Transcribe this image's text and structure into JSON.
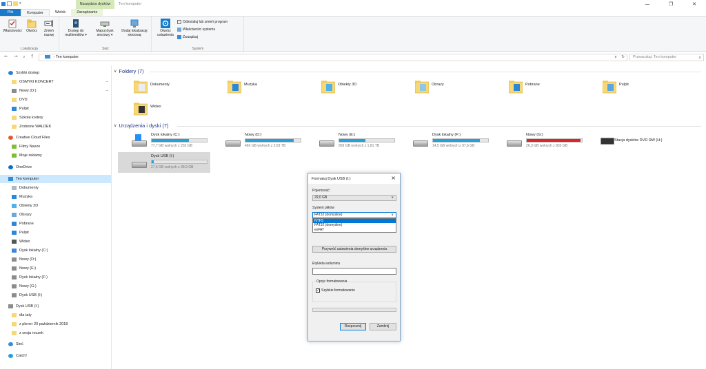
{
  "titlebar": {
    "context_tab_label": "Narzędzia dysków",
    "window_title": "Ten komputer",
    "controls": [
      "—",
      "❐",
      "✕"
    ]
  },
  "ribbon_tabs": [
    "Plik",
    "Komputer",
    "Widok",
    "Zarządzanie"
  ],
  "ribbon": {
    "groups": [
      {
        "label": "Lokalizacja",
        "buttons": [
          "Właściwości",
          "Otwórz",
          "Zmień nazwę"
        ]
      },
      {
        "label": "Sieć",
        "buttons": [
          "Dostęp do multimediów ▾",
          "Mapuj dysk sieciowy ▾",
          "Dodaj lokalizację sieciową"
        ]
      },
      {
        "label": "System",
        "buttons": [
          "Otwórz ustawienia"
        ],
        "small": [
          "Odinstaluj lub zmień program",
          "Właściwości systemu",
          "Zarządzaj"
        ]
      }
    ]
  },
  "address": {
    "path": "Ten komputer",
    "search_placeholder": "Przeszukaj: Ten komputer",
    "nav": [
      "←",
      "→",
      "∨",
      "↑"
    ]
  },
  "nav_pane": [
    {
      "label": "Szybki dostęp",
      "icon": "star-icon",
      "indent": 0,
      "color": "#2f7fd1"
    },
    {
      "label": "OSMYKI KONCERT",
      "icon": "folder-icon",
      "indent": 1,
      "pinned": true,
      "color": "#f8d775"
    },
    {
      "label": "Nowy (D:)",
      "icon": "drive-icon",
      "indent": 1,
      "pinned": true,
      "color": "#8c8c8c"
    },
    {
      "label": "DVD",
      "icon": "folder-icon",
      "indent": 1,
      "color": "#f8d775"
    },
    {
      "label": "Pulpit",
      "icon": "desktop-icon",
      "indent": 1,
      "color": "#2b88d8"
    },
    {
      "label": "Szkoła kodery",
      "icon": "folder-icon",
      "indent": 1,
      "color": "#f8d775"
    },
    {
      "label": "Zrobione WALDEK",
      "icon": "folder-icon",
      "indent": 1,
      "color": "#f8d775"
    },
    {
      "label": "Creative Cloud Files",
      "icon": "creative-cloud-icon",
      "indent": 0,
      "color": "#e8552f"
    },
    {
      "label": "Filmy Nasze",
      "icon": "folder-sync-icon",
      "indent": 1,
      "color": "#7fbd3a"
    },
    {
      "label": "Moje reklamy",
      "icon": "folder-sync-icon",
      "indent": 1,
      "color": "#7fbd3a"
    },
    {
      "label": "OneDrive",
      "icon": "onedrive-icon",
      "indent": 0,
      "color": "#0f6ecd"
    },
    {
      "label": "Ten komputer",
      "icon": "computer-icon",
      "indent": 0,
      "selected": true,
      "color": "#3a8ad6"
    },
    {
      "label": "Dokumenty",
      "icon": "documents-icon",
      "indent": 1,
      "color": "#b0b8c4"
    },
    {
      "label": "Muzyka",
      "icon": "music-icon",
      "indent": 1,
      "color": "#2b88d8"
    },
    {
      "label": "Obiekty 3D",
      "icon": "objects-3d-icon",
      "indent": 1,
      "color": "#4fb3e8"
    },
    {
      "label": "Obrazy",
      "icon": "pictures-icon",
      "indent": 1,
      "color": "#6fa8d6"
    },
    {
      "label": "Pobrane",
      "icon": "downloads-icon",
      "indent": 1,
      "color": "#2b88d8"
    },
    {
      "label": "Pulpit",
      "icon": "desktop-icon",
      "indent": 1,
      "color": "#2b88d8"
    },
    {
      "label": "Wideo",
      "icon": "video-icon",
      "indent": 1,
      "color": "#555555"
    },
    {
      "label": "Dysk lokalny (C:)",
      "icon": "windows-drive-icon",
      "indent": 1,
      "color": "#3a8ad6"
    },
    {
      "label": "Nowy (D:)",
      "icon": "drive-icon",
      "indent": 1,
      "color": "#8c8c8c"
    },
    {
      "label": "Nowy (E:)",
      "icon": "drive-icon",
      "indent": 1,
      "color": "#8c8c8c"
    },
    {
      "label": "Dysk lokalny (F:)",
      "icon": "drive-icon",
      "indent": 1,
      "color": "#8c8c8c"
    },
    {
      "label": "Nowy (G:)",
      "icon": "drive-icon",
      "indent": 1,
      "color": "#8c8c8c"
    },
    {
      "label": "Dysk USB (I:)",
      "icon": "usb-drive-icon",
      "indent": 1,
      "color": "#8c8c8c"
    },
    {
      "label": "Dysk USB (I:)",
      "icon": "usb-drive-icon",
      "indent": 0,
      "color": "#8c8c8c"
    },
    {
      "label": "dla taty",
      "icon": "folder-icon",
      "indent": 1,
      "color": "#f8d775"
    },
    {
      "label": "z plener 20 październik 2018",
      "icon": "folder-icon",
      "indent": 1,
      "color": "#f8d775"
    },
    {
      "label": "z sesja roczek",
      "icon": "folder-icon",
      "indent": 1,
      "color": "#f8d775"
    },
    {
      "label": "Sieć",
      "icon": "network-icon",
      "indent": 0,
      "color": "#3a8ad6"
    },
    {
      "label": "Catch!",
      "icon": "catch-icon",
      "indent": 0,
      "color": "#1fa0e0"
    }
  ],
  "folders_header": "Foldery (7)",
  "folders": [
    {
      "label": "Dokumenty",
      "icon": "documents-folder-icon"
    },
    {
      "label": "Muzyka",
      "icon": "music-folder-icon"
    },
    {
      "label": "Obiekty 3D",
      "icon": "objects-3d-folder-icon"
    },
    {
      "label": "Obrazy",
      "icon": "pictures-folder-icon"
    },
    {
      "label": "Pobrane",
      "icon": "downloads-folder-icon"
    },
    {
      "label": "Pulpit",
      "icon": "desktop-folder-icon"
    },
    {
      "label": "Wideo",
      "icon": "video-folder-icon"
    }
  ],
  "drives_header": "Urządzenia i dyski (7)",
  "drives": [
    {
      "label": "Dysk lokalny (C:)",
      "free": "77,7 GB wolnych z 232 GB",
      "used_fraction": 0.67,
      "icon": "windows-drive-icon"
    },
    {
      "label": "Nowy (D:)",
      "free": "469 GB wolnych z 3,63 TB",
      "used_fraction": 0.87,
      "icon": "hdd-icon"
    },
    {
      "label": "Nowy (E:)",
      "free": "959 GB wolnych z 1,81 TB",
      "used_fraction": 0.48,
      "icon": "hdd-icon"
    },
    {
      "label": "Dysk lokalny (F:)",
      "free": "14,5 GB wolnych z 97,6 GB",
      "used_fraction": 0.85,
      "icon": "hdd-icon"
    },
    {
      "label": "Nowy (G:)",
      "free": "26,3 GB wolnych z 833 GB",
      "used_fraction": 0.97,
      "red": true,
      "icon": "hdd-icon"
    },
    {
      "label": "Stacja dysków DVD RW (H:)",
      "free": "",
      "used_fraction": null,
      "icon": "dvd-drive-icon"
    },
    {
      "label": "Dysk USB (I:)",
      "free": "27,6 GB wolnych z 28,9 GB",
      "used_fraction": 0.04,
      "selected": true,
      "icon": "usb-drive-icon"
    }
  ],
  "format_dialog": {
    "title": "Formatuj Dysk USB (I:)",
    "capacity_label": "Pojemność:",
    "capacity_value": "29,0 GB",
    "fs_label": "System plików",
    "fs_value": "FAT32 (domyślne)",
    "fs_options": [
      "NTFS",
      "FAT32 (domyślne)",
      "exFAT"
    ],
    "fs_highlighted": "NTFS",
    "restore_button": "Przywróć ustawienia domyślne urządzenia",
    "volume_label": "Etykieta woluminu",
    "volume_value": "",
    "options_label": "Opcje formatowania",
    "quick_format_label": "Szybkie formatowanie",
    "quick_format_checked": true,
    "progress": 0,
    "start_button": "Rozpocznij",
    "close_button": "Zamknij"
  },
  "colors": {
    "accent": "#0078d7",
    "file_tab": "#1979ca",
    "bar_fill": "#26a0da",
    "bar_full": "#da2626",
    "selection": "#cce8ff"
  }
}
